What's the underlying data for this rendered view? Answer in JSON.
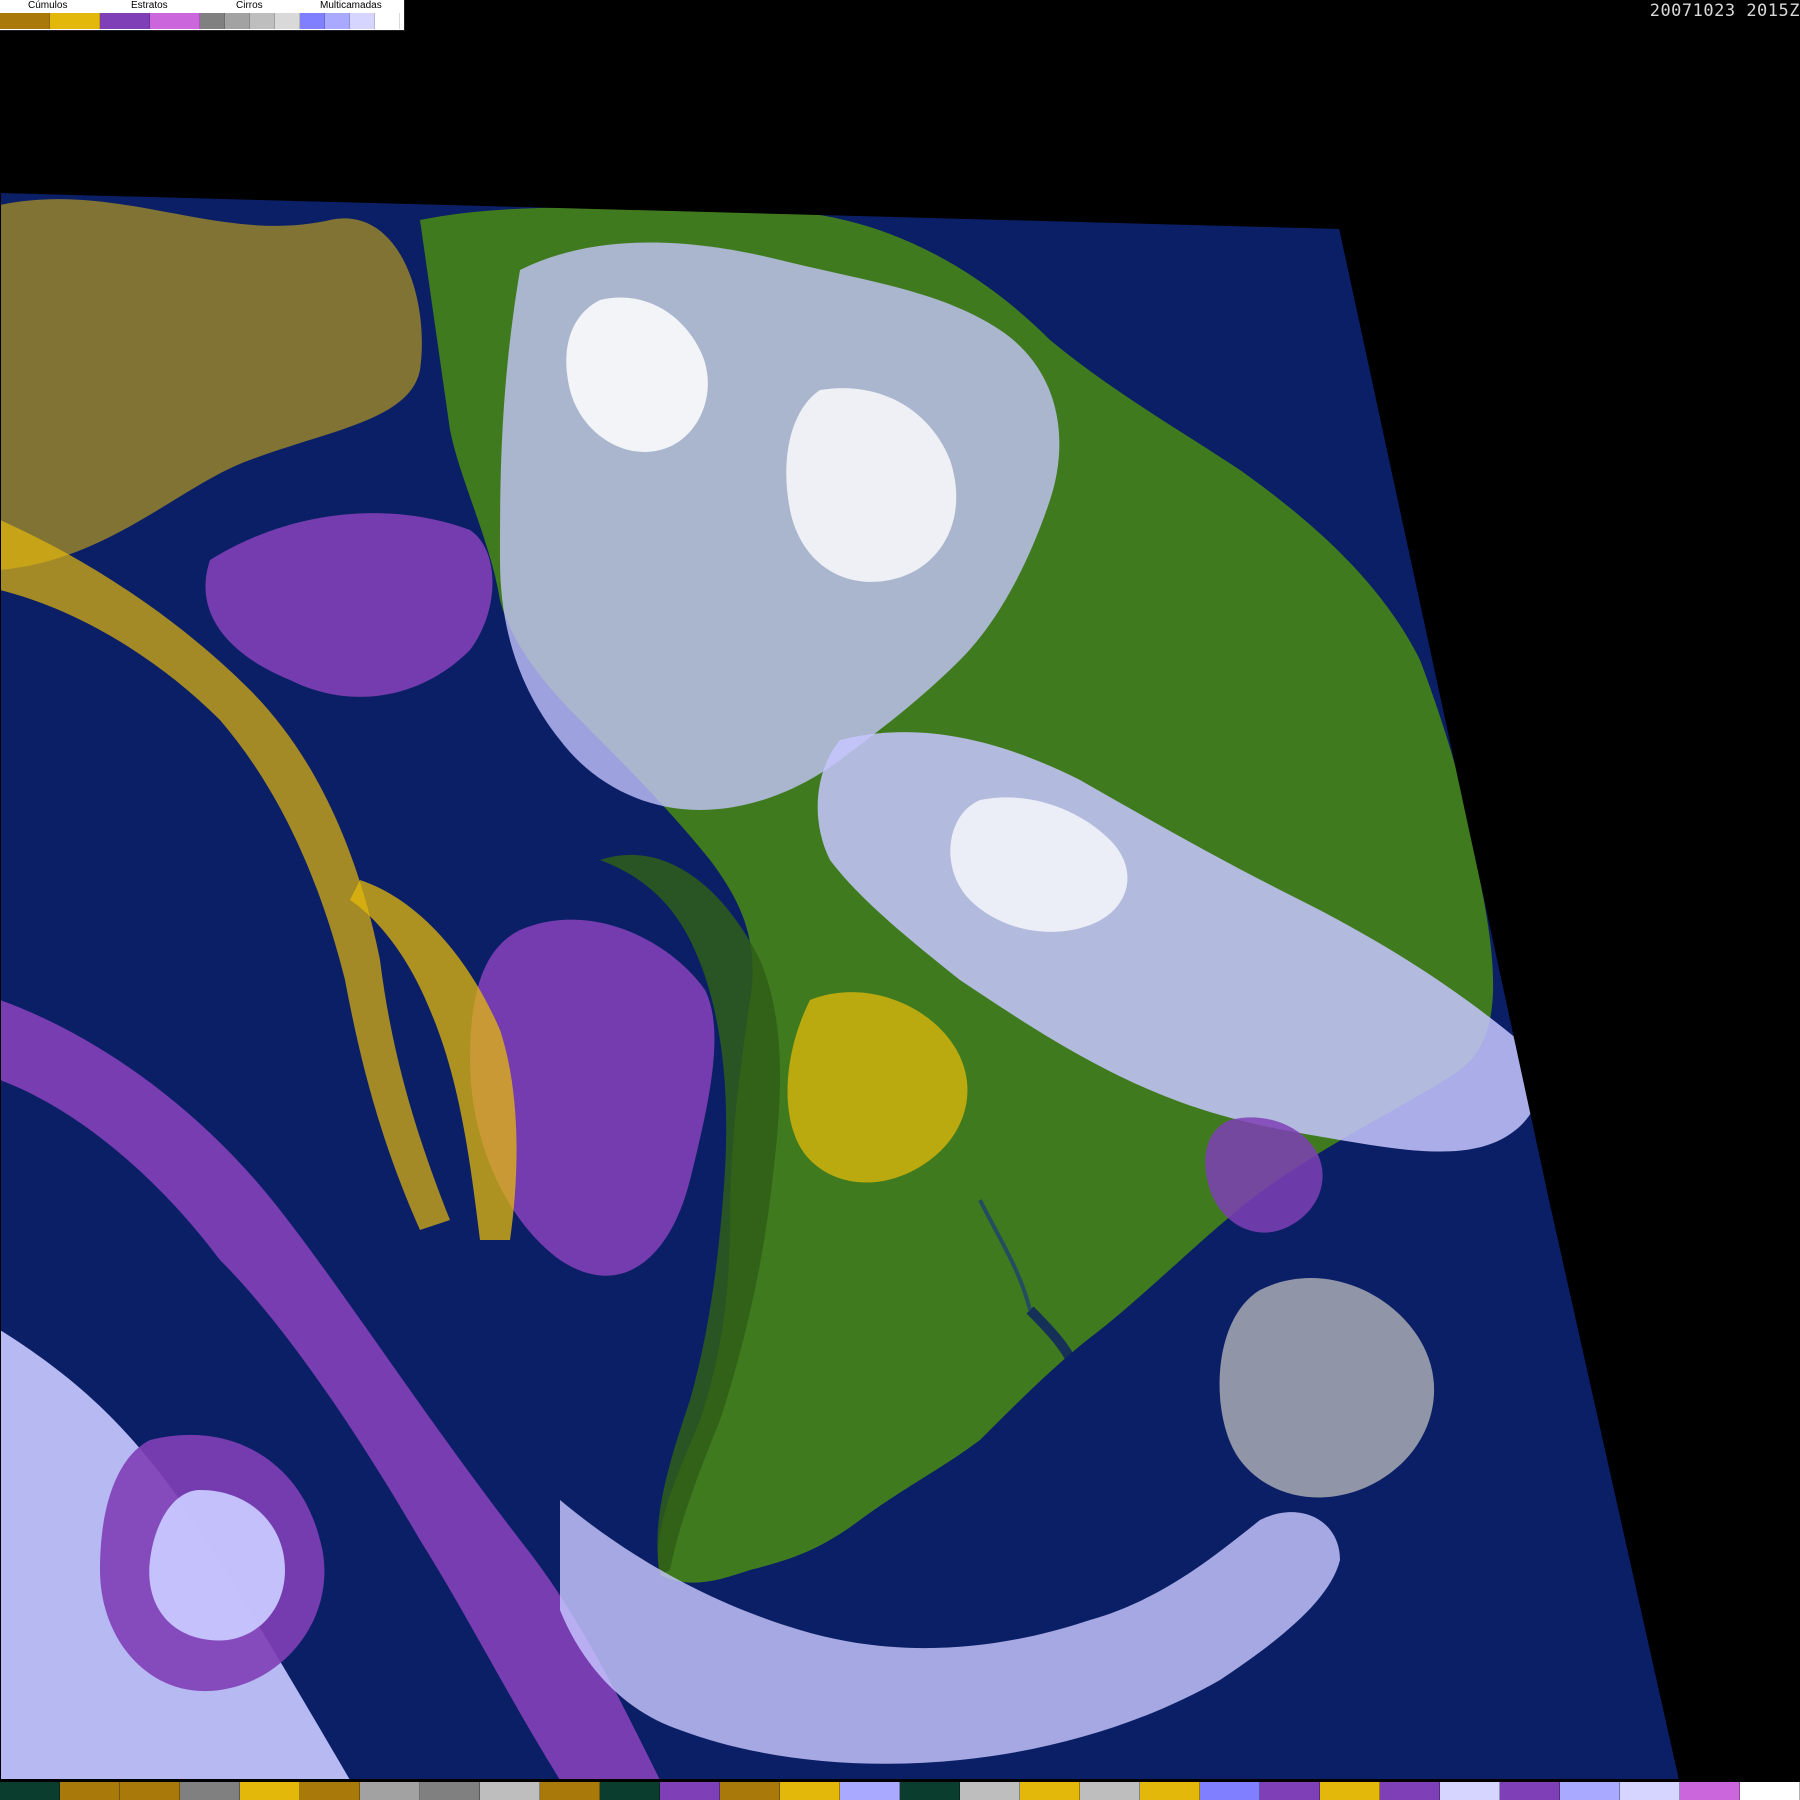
{
  "legend": {
    "titles": {
      "cumulos": "Cúmulos",
      "estratos": "Estratos",
      "cirros": "Cirros",
      "multicamadas": "Multicamadas"
    },
    "swatches": [
      {
        "color": "#a97a0a"
      },
      {
        "color": "#e4b80b"
      },
      {
        "color": "#7f3fb6"
      },
      {
        "color": "#cc66dd"
      },
      {
        "color": "#808080"
      },
      {
        "color": "#a2a2a2"
      },
      {
        "color": "#bebebe"
      },
      {
        "color": "#d9d9d9"
      },
      {
        "color": "#7f7fff"
      },
      {
        "color": "#a9a9ff"
      },
      {
        "color": "#d5d5ff"
      },
      {
        "color": "#ffffff"
      }
    ]
  },
  "timestamp": "20071023 2015Z",
  "colors": {
    "background": "#000000",
    "ocean": "#0b1f66",
    "land": "#3f7b1e",
    "land_dark": "#2f5e17",
    "cumulus_brown": "#a97a0a",
    "cumulus_yellow": "#e4b80b",
    "stratus_purple": "#7f3fb6",
    "stratus_magenta": "#cc66dd",
    "cirrus_gray": "#bebebe",
    "multilayer_lavender": "#c7c7ff",
    "multilayer_white": "#ffffff"
  },
  "bottom_strip": [
    {
      "color": "#0b3d2f"
    },
    {
      "color": "#a97a0a"
    },
    {
      "color": "#a97a0a"
    },
    {
      "color": "#808080"
    },
    {
      "color": "#e4b80b"
    },
    {
      "color": "#a97a0a"
    },
    {
      "color": "#a2a2a2"
    },
    {
      "color": "#808080"
    },
    {
      "color": "#bebebe"
    },
    {
      "color": "#a97a0a"
    },
    {
      "color": "#0b3d2f"
    },
    {
      "color": "#7f3fb6"
    },
    {
      "color": "#a97a0a"
    },
    {
      "color": "#e4b80b"
    },
    {
      "color": "#a9a9ff"
    },
    {
      "color": "#0b3d2f"
    },
    {
      "color": "#bebebe"
    },
    {
      "color": "#e4b80b"
    },
    {
      "color": "#bebebe"
    },
    {
      "color": "#e4b80b"
    },
    {
      "color": "#7f7fff"
    },
    {
      "color": "#7f3fb6"
    },
    {
      "color": "#e4b80b"
    },
    {
      "color": "#7f3fb6"
    },
    {
      "color": "#d5d5ff"
    },
    {
      "color": "#7f3fb6"
    },
    {
      "color": "#a9a9ff"
    },
    {
      "color": "#d5d5ff"
    },
    {
      "color": "#cc66dd"
    },
    {
      "color": "#ffffff"
    }
  ]
}
